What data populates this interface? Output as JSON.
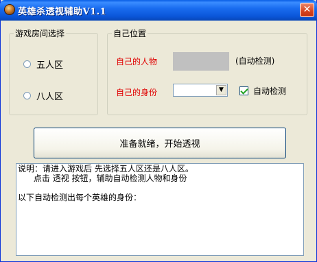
{
  "window": {
    "title": "英雄杀透视辅助V1.1",
    "close_glyph": "✕"
  },
  "room_group": {
    "label": "游戏房间选择",
    "options": [
      {
        "label": "五人区",
        "selected": false
      },
      {
        "label": "八人区",
        "selected": false
      }
    ]
  },
  "self_group": {
    "label": "自己位置",
    "character_label": "自己的人物",
    "auto_detect_note": "(自动检测)",
    "identity_label": "自己的身份",
    "identity_value": "",
    "auto_detect_checkbox": {
      "label": "自动检测",
      "checked": true
    }
  },
  "start_button": {
    "label": "准备就绪，开始透视"
  },
  "info_text": {
    "line1": "说明：请进入游戏后 先选择五人区还是八人区。",
    "line2": "      点击 透视 按钮，辅助自动检测人物和身份",
    "line3": "",
    "line4": "以下自动检测出每个英雄的身份："
  },
  "colors": {
    "titlebar": "#0a55d8",
    "window_bg": "#ece9d8",
    "red_label": "#e00000",
    "character_box": "#c0c0c0"
  }
}
